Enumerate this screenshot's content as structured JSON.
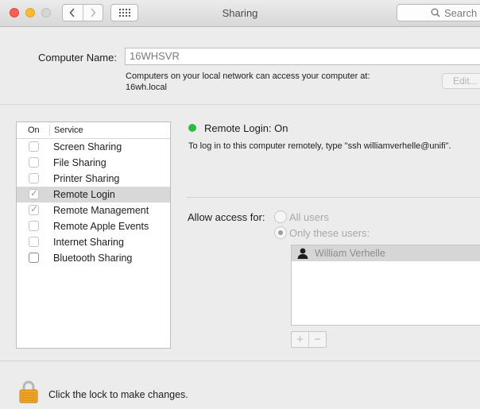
{
  "window": {
    "title": "Sharing",
    "search_placeholder": "Search"
  },
  "computer_name": {
    "label": "Computer Name:",
    "value": "16WHSVR",
    "help_line1": "Computers on your local network can access your computer at:",
    "help_line2": "16wh.local",
    "edit_label": "Edit..."
  },
  "services": {
    "col_on": "On",
    "col_service": "Service",
    "items": [
      {
        "label": "Screen Sharing",
        "checked": false
      },
      {
        "label": "File Sharing",
        "checked": false
      },
      {
        "label": "Printer Sharing",
        "checked": false
      },
      {
        "label": "Remote Login",
        "checked": true,
        "selected": true
      },
      {
        "label": "Remote Management",
        "checked": true
      },
      {
        "label": "Remote Apple Events",
        "checked": false
      },
      {
        "label": "Internet Sharing",
        "checked": false
      },
      {
        "label": "Bluetooth Sharing",
        "checked": false
      }
    ]
  },
  "detail": {
    "status": "Remote Login: On",
    "status_color": "#2dbb3e",
    "instructions": "To log in to this computer remotely, type \"ssh williamverhelle@unifi\".",
    "access_label": "Allow access for:",
    "option_all": "All users",
    "option_only": "Only these users:",
    "users": [
      "William Verhelle"
    ],
    "add_label": "+",
    "remove_label": "−"
  },
  "footer": {
    "lock_text": "Click the lock to make changes."
  }
}
